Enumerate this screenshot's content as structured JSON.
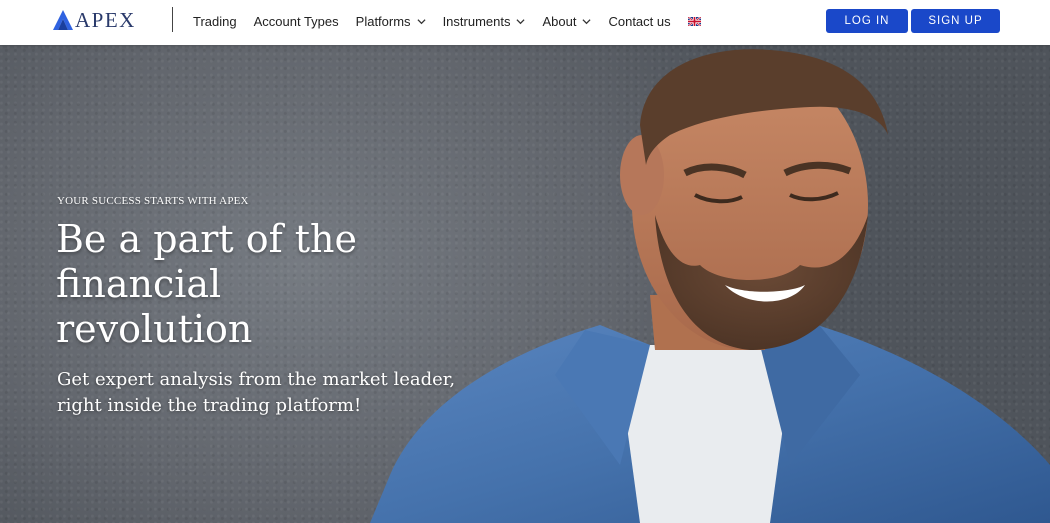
{
  "brand": {
    "name": "APEX",
    "accent": "#1a48c9"
  },
  "nav": {
    "items": [
      {
        "label": "Trading",
        "dropdown": false
      },
      {
        "label": "Account Types",
        "dropdown": false
      },
      {
        "label": "Platforms",
        "dropdown": true
      },
      {
        "label": "Instruments",
        "dropdown": true
      },
      {
        "label": "About",
        "dropdown": true
      },
      {
        "label": "Contact us",
        "dropdown": false
      }
    ],
    "language_icon": "uk-flag-icon"
  },
  "auth": {
    "login_label": "LOG IN",
    "signup_label": "SIGN UP"
  },
  "hero": {
    "eyebrow": "YOUR SUCCESS STARTS WITH APEX",
    "headline": "Be a part of the financial revolution",
    "subline": "Get expert analysis from the market leader, right inside the trading platform!"
  }
}
